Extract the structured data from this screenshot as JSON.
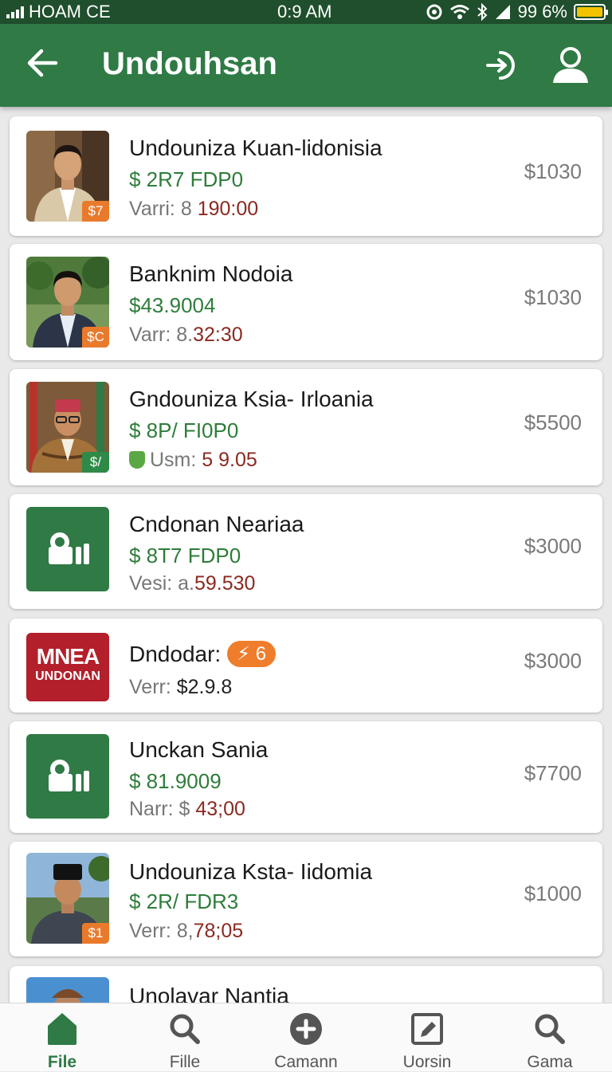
{
  "status_bar": {
    "carrier": "HOAM CE",
    "time": "0:9 AM",
    "battery": "99 6%"
  },
  "app_bar": {
    "title": "Undouhsan"
  },
  "items": [
    {
      "name": "Undouniza Kuan-lidonisia",
      "subtitle": "$ 2R7 FDP0",
      "meta_label": "Varri: 8",
      "meta_value": "190:00",
      "price": "$1030",
      "badge": "$7"
    },
    {
      "name": "Banknim Nodoia",
      "subtitle": "$43.9004",
      "meta_label": "Varr: 8.",
      "meta_value": "32:30",
      "price": "$1030",
      "badge": "$C"
    },
    {
      "name": "Gndouniza Ksia- Irloania",
      "subtitle": "$ 8P/ FI0P0",
      "meta_label": "Usm:",
      "meta_value": "5 9.05",
      "price": "$5500",
      "badge": "$/"
    },
    {
      "name": "Cndonan Neariaa",
      "subtitle": "$ 8T7 FDP0",
      "meta_label": "Vesi: a.",
      "meta_value": "59.530",
      "price": "$3000"
    },
    {
      "name": "Dndodar:",
      "pill": "⚡ 6",
      "meta_label": "Verr:",
      "meta_value": "$2.9.8",
      "price": "$3000",
      "logo_line1": "MNEA",
      "logo_line2": "UNDONAN"
    },
    {
      "name": "Unckan Sania",
      "subtitle": "$ 81.9009",
      "meta_label": "Narr: $",
      "meta_value": "43;00",
      "price": "$7700"
    },
    {
      "name": "Undouniza Ksta- Iidomia",
      "subtitle": "$ 2R/ FDR3",
      "meta_label": "Verr: 8,",
      "meta_value": "78;05",
      "price": "$1000",
      "badge": "$1"
    },
    {
      "name": "Unolavar Nantia"
    }
  ],
  "nav": [
    {
      "label": "File",
      "icon": "home-icon"
    },
    {
      "label": "Fille",
      "icon": "search-icon"
    },
    {
      "label": "Camann",
      "icon": "add-circle-icon"
    },
    {
      "label": "Uorsin",
      "icon": "edit-icon"
    },
    {
      "label": "Gama",
      "icon": "search-icon"
    }
  ],
  "colors": {
    "status_bar": "#1f4f2c",
    "app_bar": "#2f7a45",
    "accent_green": "#2e7d3a",
    "meta_value": "#8a2a20",
    "badge_orange": "#e97a2c",
    "logo_red": "#b31f2a"
  }
}
